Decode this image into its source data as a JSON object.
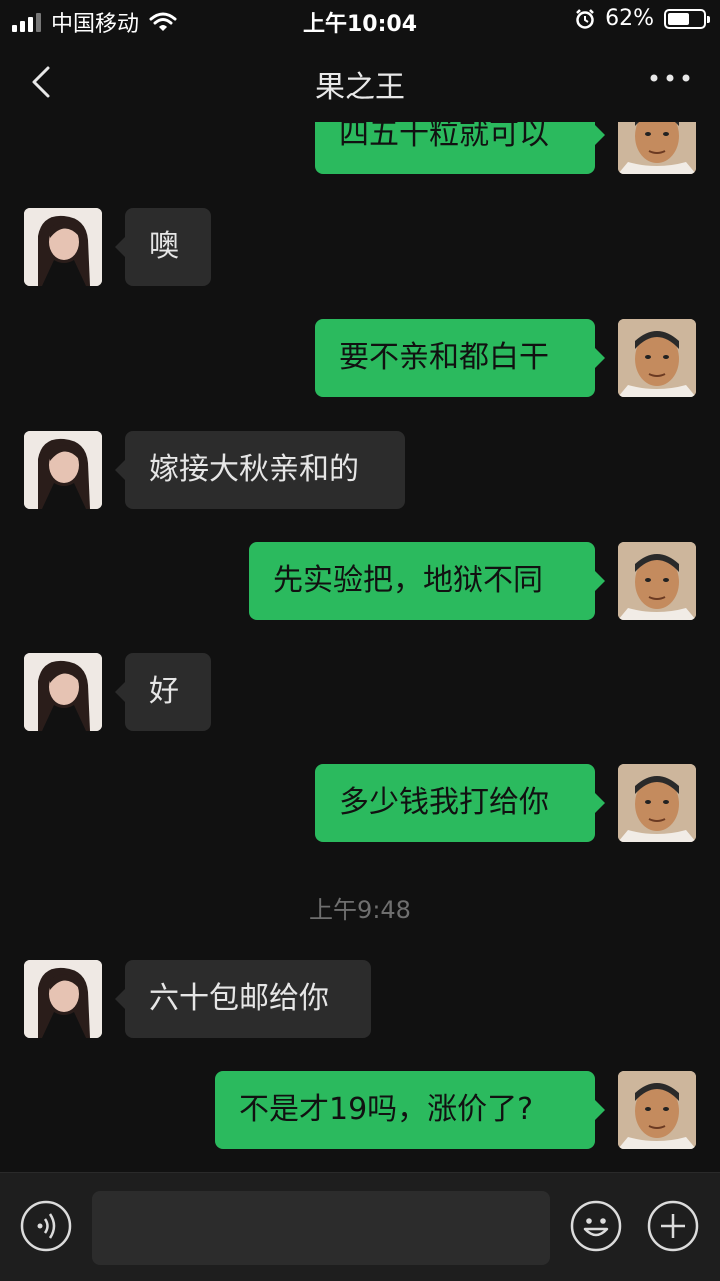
{
  "status_bar": {
    "carrier": "中国移动",
    "time": "上午10:04",
    "battery_percent": "62%",
    "battery_level": 0.62,
    "icons": [
      "signal-icon",
      "wifi-icon",
      "alarm-icon",
      "battery-icon"
    ]
  },
  "nav": {
    "title": "果之王",
    "back_icon": "chevron-left-icon",
    "more_icon": "more-dots-icon"
  },
  "messages": [
    {
      "side": "right",
      "text": "四五十粒就可以"
    },
    {
      "side": "left",
      "text": "噢"
    },
    {
      "side": "right",
      "text": "要不亲和都白干"
    },
    {
      "side": "left",
      "text": "嫁接大秋亲和的"
    },
    {
      "side": "right",
      "text": "先实验把，地狱不同"
    },
    {
      "side": "left",
      "text": "好"
    },
    {
      "side": "right",
      "text": "多少钱我打给你"
    },
    {
      "side": "left",
      "text": "六十包邮给你"
    },
    {
      "side": "right",
      "text": "不是才19吗，涨价了?"
    }
  ],
  "timestamp": "上午9:48",
  "input_bar": {
    "voice_icon": "voice-icon",
    "emoji_icon": "emoji-icon",
    "plus_icon": "plus-icon",
    "placeholder": ""
  },
  "colors": {
    "background": "#111111",
    "bubble_self": "#2bba5e",
    "bubble_other": "#2c2c2c",
    "timestamp": "#6f6f6f"
  }
}
